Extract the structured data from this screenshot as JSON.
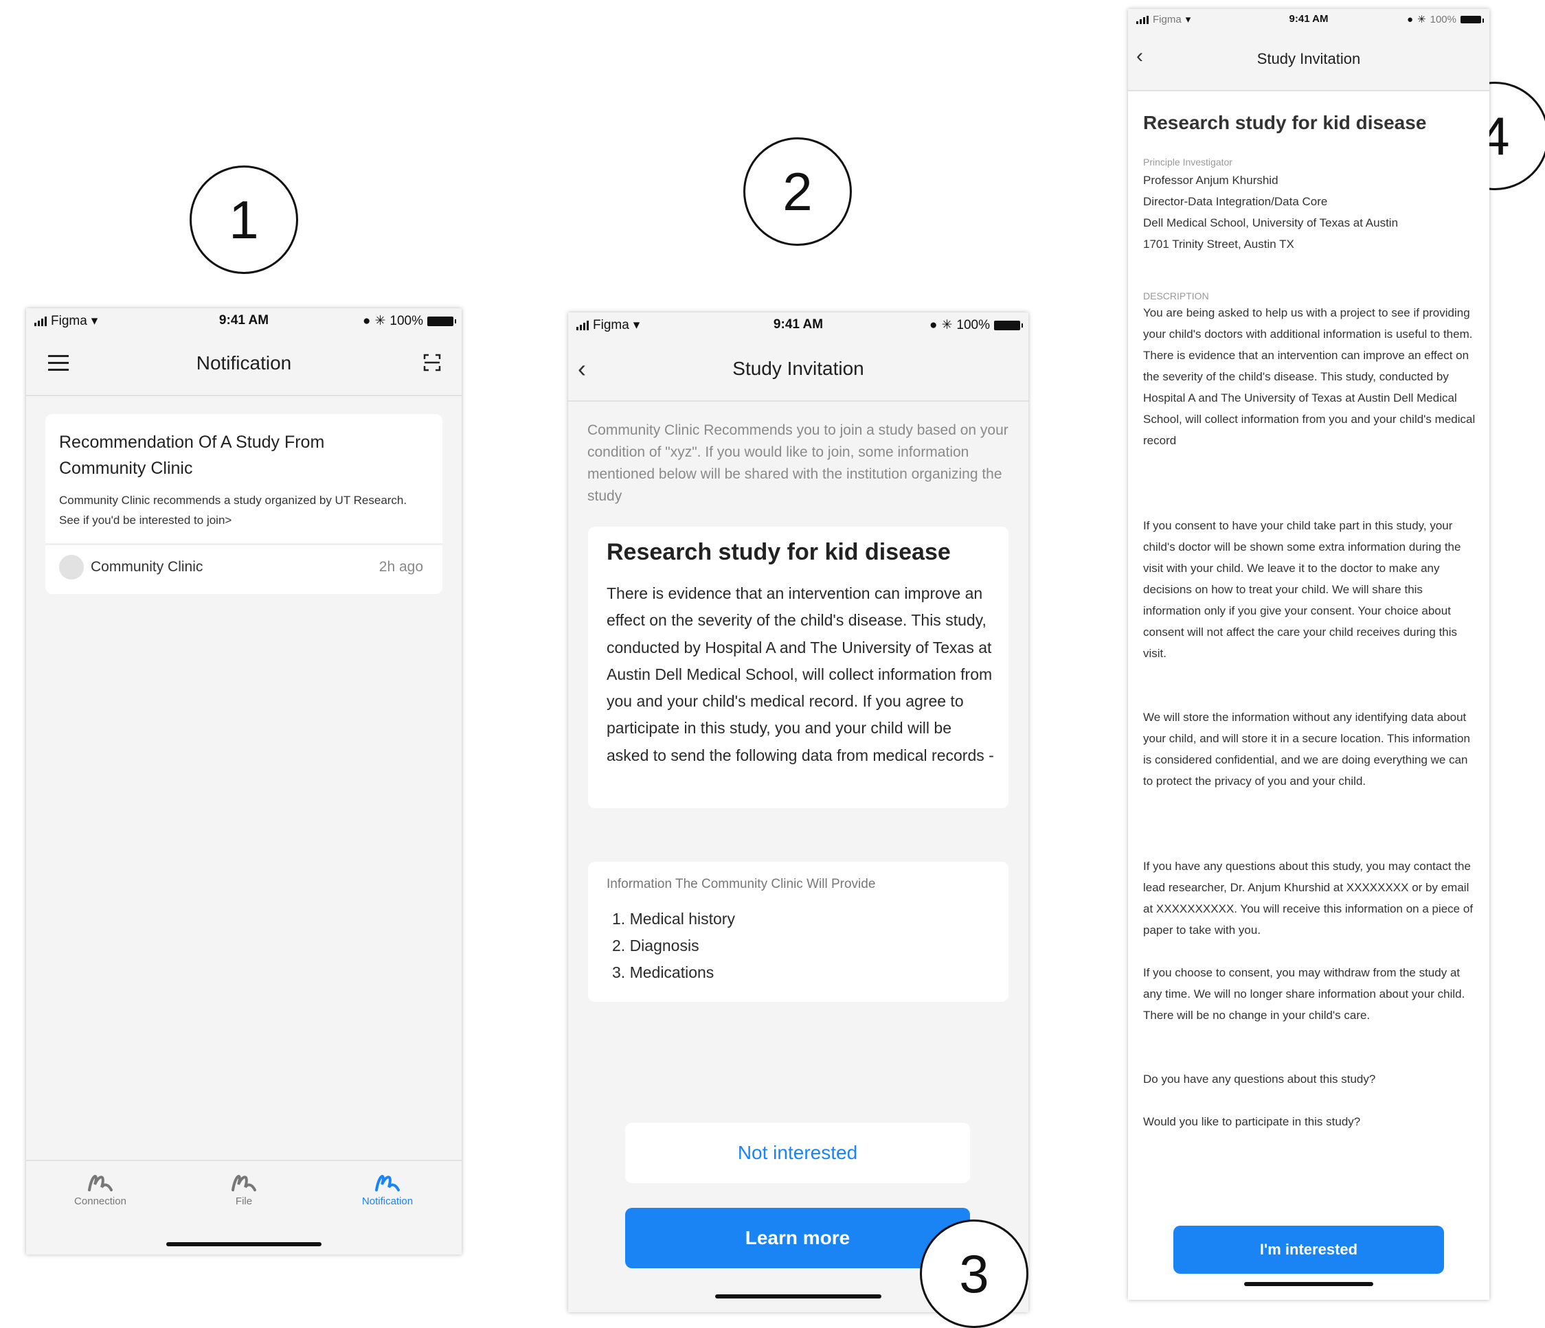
{
  "badges": {
    "b1": "1",
    "b2": "2",
    "b3": "3",
    "b4": "4"
  },
  "status": {
    "carrier": "Figma",
    "time": "9:41 AM",
    "battery": "100%"
  },
  "screen1": {
    "title": "Notification",
    "card": {
      "title": "Recommendation Of A Study From Community Clinic",
      "body": "Community Clinic recommends a study organized by UT Research. See if you'd be interested to join>",
      "sender": "Community Clinic",
      "time": "2h ago"
    },
    "tabs": [
      {
        "label": "Connection",
        "active": false
      },
      {
        "label": "File",
        "active": false
      },
      {
        "label": "Notification",
        "active": true
      }
    ]
  },
  "screen2": {
    "title": "Study Invitation",
    "intro": "Community Clinic Recommends you to join a study based on your condition of \"xyz\". If you would like to join, some information mentioned below will be shared with the institution organizing the study",
    "study_title": "Research study for kid disease",
    "study_body": "There is evidence that an intervention can improve an effect on the severity of the child's disease. This study, conducted by Hospital A and The University of Texas at Austin Dell Medical School, will collect information from you and your child's medical record. If you agree to participate in this study, you and your child will be asked to send the following data from medical records -",
    "info_heading": "Information The Community Clinic Will Provide",
    "info_items": [
      "1. Medical history",
      "2. Diagnosis",
      "3. Medications"
    ],
    "btn_not_interested": "Not interested",
    "btn_learn_more": "Learn more"
  },
  "screen3": {
    "title": "Study Invitation",
    "study_title": "Research study for kid disease",
    "pi_label": "Principle Investigator",
    "pi_lines": [
      "Professor Anjum Khurshid",
      "Director-Data Integration/Data Core",
      "Dell Medical School, University of Texas at Austin",
      "1701 Trinity Street, Austin TX"
    ],
    "desc_label": "DESCRIPTION",
    "paragraphs": [
      "You are being asked to help us with a project to see if providing your child's doctors with additional information is useful to them. There is evidence that an intervention can improve an effect on the severity of the child's disease. This study, conducted by Hospital A and The University of Texas at Austin Dell Medical School, will collect information from you and your child's medical record",
      "If you consent to have your child take part in this study, your child's doctor will be shown some extra information during the visit with your child. We leave it to the doctor to make any decisions on how to treat your child. We will share this information only if you give your consent. Your choice about consent will not affect the care your child receives during this visit.",
      "We will store the information without any identifying data about your child, and will store it in a secure location. This information is considered confidential, and we are doing everything we can to protect the privacy of you and your child.",
      "If you have any questions about this study, you may contact the lead researcher, Dr. Anjum Khurshid at XXXXXXXX or by email at XXXXXXXXXX. You will receive this information on a piece of paper to take with you.",
      "If you choose to consent, you may withdraw from the study at any time. We will no longer share information about your child. There will be no change in your child's care.",
      "Do you have any questions about this study?",
      "Would you like to participate in this study?"
    ],
    "btn_interested": "I'm interested"
  },
  "colors": {
    "accent": "#1a84f5",
    "background": "#f4f4f4",
    "card": "#ffffff"
  }
}
